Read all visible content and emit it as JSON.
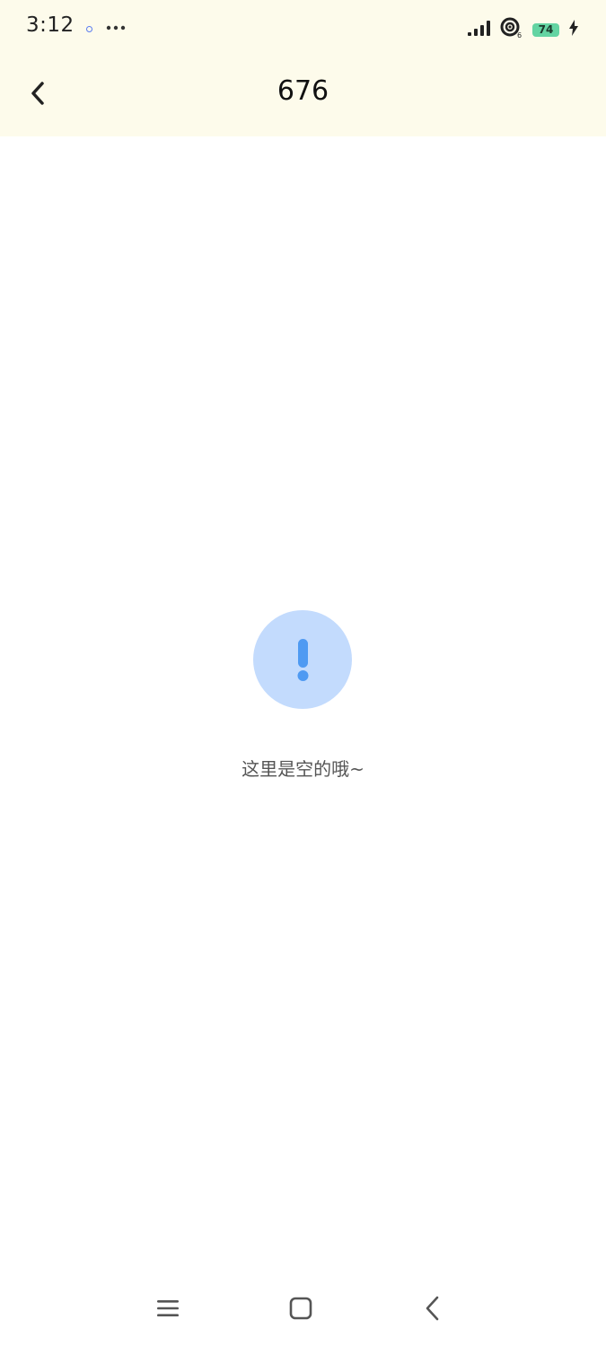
{
  "status_bar": {
    "time": "3:12",
    "battery_level": "74",
    "icons": [
      "notification-dot-icon",
      "more-dots-icon",
      "signal-icon",
      "wifi-icon",
      "battery-icon",
      "charging-icon"
    ]
  },
  "header": {
    "title": "676",
    "back_icon": "chevron-left-icon"
  },
  "empty_state": {
    "icon": "exclamation-circle-icon",
    "message": "这里是空的哦~"
  },
  "system_nav": {
    "icons": [
      "menu-icon",
      "home-icon",
      "back-icon"
    ]
  },
  "colors": {
    "header_background": "#fdfbeb",
    "empty_icon_background": "#c3dbfd",
    "empty_icon_mark": "#4f9af2",
    "battery_fill": "#63d4a2"
  }
}
